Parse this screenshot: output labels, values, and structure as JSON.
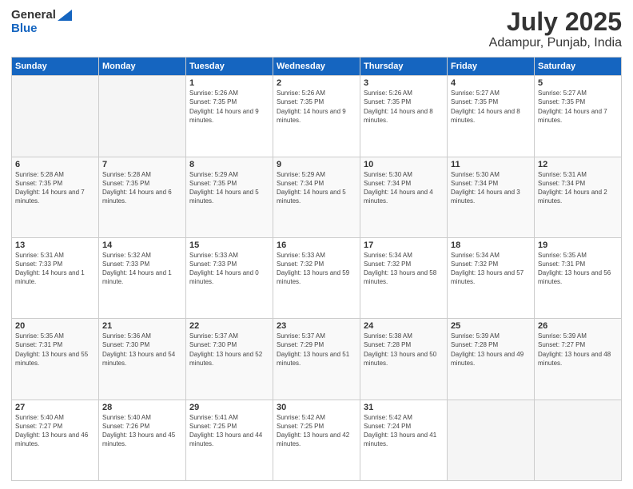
{
  "header": {
    "logo": {
      "line1": "General",
      "line2": "Blue"
    },
    "month": "July 2025",
    "location": "Adampur, Punjab, India"
  },
  "weekdays": [
    "Sunday",
    "Monday",
    "Tuesday",
    "Wednesday",
    "Thursday",
    "Friday",
    "Saturday"
  ],
  "weeks": [
    [
      {
        "day": "",
        "sunrise": "",
        "sunset": "",
        "daylight": "",
        "empty": true
      },
      {
        "day": "",
        "sunrise": "",
        "sunset": "",
        "daylight": "",
        "empty": true
      },
      {
        "day": "1",
        "sunrise": "Sunrise: 5:26 AM",
        "sunset": "Sunset: 7:35 PM",
        "daylight": "Daylight: 14 hours and 9 minutes.",
        "empty": false
      },
      {
        "day": "2",
        "sunrise": "Sunrise: 5:26 AM",
        "sunset": "Sunset: 7:35 PM",
        "daylight": "Daylight: 14 hours and 9 minutes.",
        "empty": false
      },
      {
        "day": "3",
        "sunrise": "Sunrise: 5:26 AM",
        "sunset": "Sunset: 7:35 PM",
        "daylight": "Daylight: 14 hours and 8 minutes.",
        "empty": false
      },
      {
        "day": "4",
        "sunrise": "Sunrise: 5:27 AM",
        "sunset": "Sunset: 7:35 PM",
        "daylight": "Daylight: 14 hours and 8 minutes.",
        "empty": false
      },
      {
        "day": "5",
        "sunrise": "Sunrise: 5:27 AM",
        "sunset": "Sunset: 7:35 PM",
        "daylight": "Daylight: 14 hours and 7 minutes.",
        "empty": false
      }
    ],
    [
      {
        "day": "6",
        "sunrise": "Sunrise: 5:28 AM",
        "sunset": "Sunset: 7:35 PM",
        "daylight": "Daylight: 14 hours and 7 minutes.",
        "empty": false
      },
      {
        "day": "7",
        "sunrise": "Sunrise: 5:28 AM",
        "sunset": "Sunset: 7:35 PM",
        "daylight": "Daylight: 14 hours and 6 minutes.",
        "empty": false
      },
      {
        "day": "8",
        "sunrise": "Sunrise: 5:29 AM",
        "sunset": "Sunset: 7:35 PM",
        "daylight": "Daylight: 14 hours and 5 minutes.",
        "empty": false
      },
      {
        "day": "9",
        "sunrise": "Sunrise: 5:29 AM",
        "sunset": "Sunset: 7:34 PM",
        "daylight": "Daylight: 14 hours and 5 minutes.",
        "empty": false
      },
      {
        "day": "10",
        "sunrise": "Sunrise: 5:30 AM",
        "sunset": "Sunset: 7:34 PM",
        "daylight": "Daylight: 14 hours and 4 minutes.",
        "empty": false
      },
      {
        "day": "11",
        "sunrise": "Sunrise: 5:30 AM",
        "sunset": "Sunset: 7:34 PM",
        "daylight": "Daylight: 14 hours and 3 minutes.",
        "empty": false
      },
      {
        "day": "12",
        "sunrise": "Sunrise: 5:31 AM",
        "sunset": "Sunset: 7:34 PM",
        "daylight": "Daylight: 14 hours and 2 minutes.",
        "empty": false
      }
    ],
    [
      {
        "day": "13",
        "sunrise": "Sunrise: 5:31 AM",
        "sunset": "Sunset: 7:33 PM",
        "daylight": "Daylight: 14 hours and 1 minute.",
        "empty": false
      },
      {
        "day": "14",
        "sunrise": "Sunrise: 5:32 AM",
        "sunset": "Sunset: 7:33 PM",
        "daylight": "Daylight: 14 hours and 1 minute.",
        "empty": false
      },
      {
        "day": "15",
        "sunrise": "Sunrise: 5:33 AM",
        "sunset": "Sunset: 7:33 PM",
        "daylight": "Daylight: 14 hours and 0 minutes.",
        "empty": false
      },
      {
        "day": "16",
        "sunrise": "Sunrise: 5:33 AM",
        "sunset": "Sunset: 7:32 PM",
        "daylight": "Daylight: 13 hours and 59 minutes.",
        "empty": false
      },
      {
        "day": "17",
        "sunrise": "Sunrise: 5:34 AM",
        "sunset": "Sunset: 7:32 PM",
        "daylight": "Daylight: 13 hours and 58 minutes.",
        "empty": false
      },
      {
        "day": "18",
        "sunrise": "Sunrise: 5:34 AM",
        "sunset": "Sunset: 7:32 PM",
        "daylight": "Daylight: 13 hours and 57 minutes.",
        "empty": false
      },
      {
        "day": "19",
        "sunrise": "Sunrise: 5:35 AM",
        "sunset": "Sunset: 7:31 PM",
        "daylight": "Daylight: 13 hours and 56 minutes.",
        "empty": false
      }
    ],
    [
      {
        "day": "20",
        "sunrise": "Sunrise: 5:35 AM",
        "sunset": "Sunset: 7:31 PM",
        "daylight": "Daylight: 13 hours and 55 minutes.",
        "empty": false
      },
      {
        "day": "21",
        "sunrise": "Sunrise: 5:36 AM",
        "sunset": "Sunset: 7:30 PM",
        "daylight": "Daylight: 13 hours and 54 minutes.",
        "empty": false
      },
      {
        "day": "22",
        "sunrise": "Sunrise: 5:37 AM",
        "sunset": "Sunset: 7:30 PM",
        "daylight": "Daylight: 13 hours and 52 minutes.",
        "empty": false
      },
      {
        "day": "23",
        "sunrise": "Sunrise: 5:37 AM",
        "sunset": "Sunset: 7:29 PM",
        "daylight": "Daylight: 13 hours and 51 minutes.",
        "empty": false
      },
      {
        "day": "24",
        "sunrise": "Sunrise: 5:38 AM",
        "sunset": "Sunset: 7:28 PM",
        "daylight": "Daylight: 13 hours and 50 minutes.",
        "empty": false
      },
      {
        "day": "25",
        "sunrise": "Sunrise: 5:39 AM",
        "sunset": "Sunset: 7:28 PM",
        "daylight": "Daylight: 13 hours and 49 minutes.",
        "empty": false
      },
      {
        "day": "26",
        "sunrise": "Sunrise: 5:39 AM",
        "sunset": "Sunset: 7:27 PM",
        "daylight": "Daylight: 13 hours and 48 minutes.",
        "empty": false
      }
    ],
    [
      {
        "day": "27",
        "sunrise": "Sunrise: 5:40 AM",
        "sunset": "Sunset: 7:27 PM",
        "daylight": "Daylight: 13 hours and 46 minutes.",
        "empty": false
      },
      {
        "day": "28",
        "sunrise": "Sunrise: 5:40 AM",
        "sunset": "Sunset: 7:26 PM",
        "daylight": "Daylight: 13 hours and 45 minutes.",
        "empty": false
      },
      {
        "day": "29",
        "sunrise": "Sunrise: 5:41 AM",
        "sunset": "Sunset: 7:25 PM",
        "daylight": "Daylight: 13 hours and 44 minutes.",
        "empty": false
      },
      {
        "day": "30",
        "sunrise": "Sunrise: 5:42 AM",
        "sunset": "Sunset: 7:25 PM",
        "daylight": "Daylight: 13 hours and 42 minutes.",
        "empty": false
      },
      {
        "day": "31",
        "sunrise": "Sunrise: 5:42 AM",
        "sunset": "Sunset: 7:24 PM",
        "daylight": "Daylight: 13 hours and 41 minutes.",
        "empty": false
      },
      {
        "day": "",
        "sunrise": "",
        "sunset": "",
        "daylight": "",
        "empty": true
      },
      {
        "day": "",
        "sunrise": "",
        "sunset": "",
        "daylight": "",
        "empty": true
      }
    ]
  ]
}
